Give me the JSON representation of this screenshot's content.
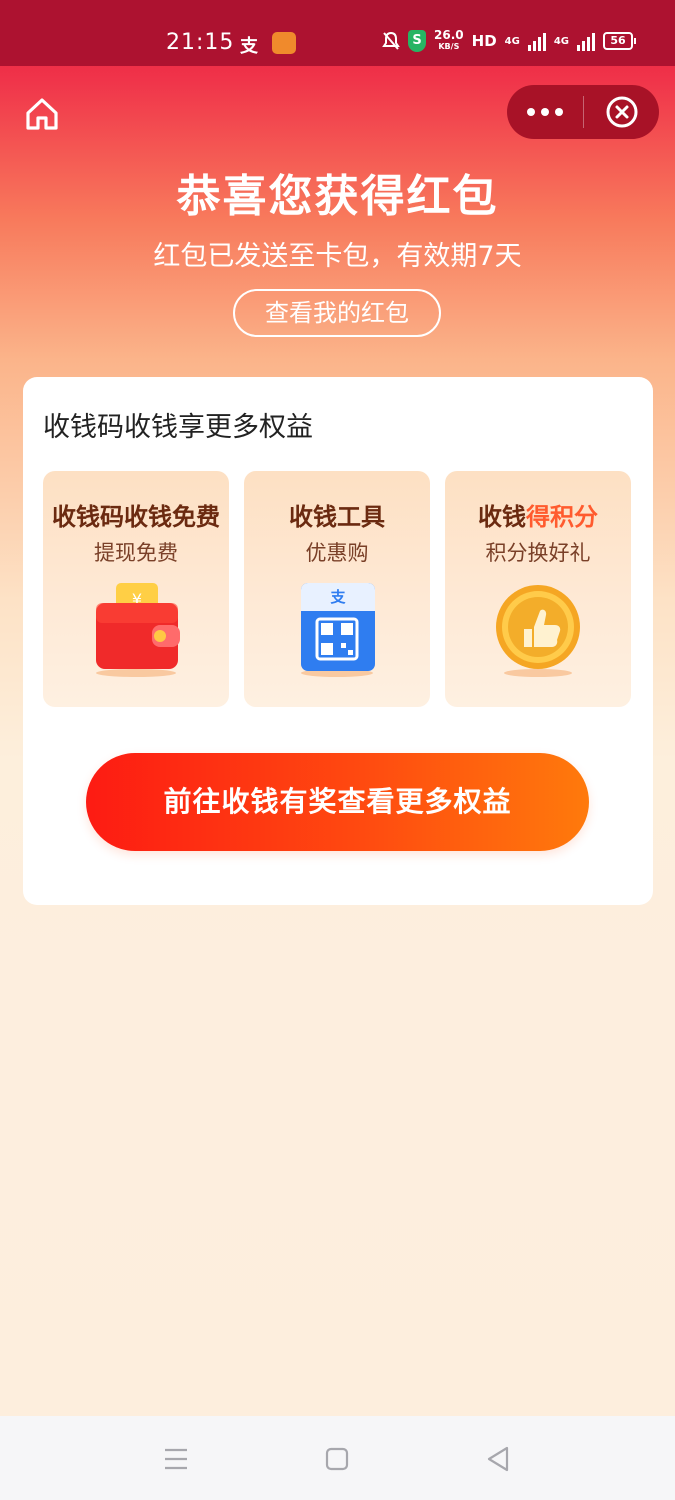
{
  "status_bar": {
    "time": "21:15",
    "app_icon_1": "支",
    "shield": "S",
    "speed_value": "26.0",
    "speed_unit": "KB/S",
    "hd": "HD",
    "net1": "4G",
    "net2": "4G",
    "battery": "56"
  },
  "header": {
    "title": "恭喜您获得红包",
    "subtitle": "红包已发送至卡包，有效期7天",
    "view_button": "查看我的红包"
  },
  "card": {
    "title": "收钱码收钱享更多权益",
    "tiles": [
      {
        "heading": "收钱码收钱免费",
        "heading_highlight": "",
        "sub": "提现免费",
        "icon": "wallet-icon"
      },
      {
        "heading": "收钱工具",
        "heading_highlight": "",
        "sub": "优惠购",
        "icon": "qr-code-stand-icon"
      },
      {
        "heading": "收钱",
        "heading_highlight": "得积分",
        "sub": "积分换好礼",
        "icon": "thumbs-up-coin-icon"
      }
    ],
    "cta": "前往收钱有奖查看更多权益"
  },
  "colors": {
    "status_bar_bg": "#ad1230",
    "accent_red": "#fd1b13",
    "accent_orange": "#ff7a0c",
    "highlight": "#ff5b2e"
  }
}
